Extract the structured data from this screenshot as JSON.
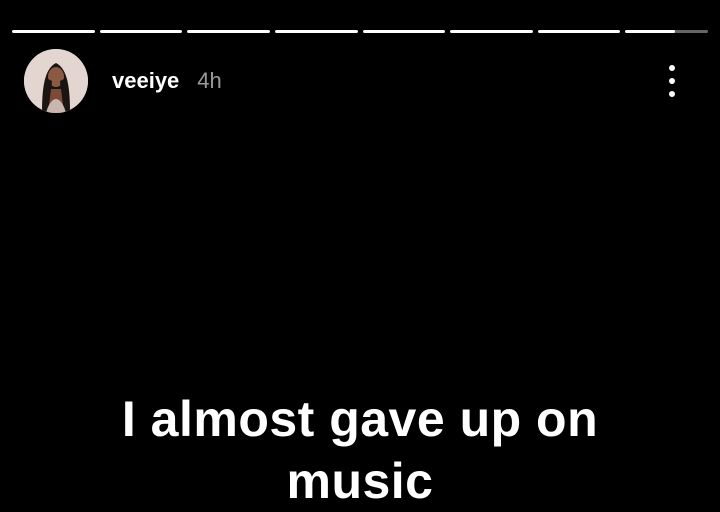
{
  "progress": {
    "segments": [
      1,
      1,
      1,
      1,
      1,
      1,
      1,
      0.6
    ]
  },
  "header": {
    "username": "veeiye",
    "time": "4h",
    "avatar_icon": "profile-photo",
    "more_icon": "more-vertical-icon"
  },
  "story": {
    "lines": [
      "I almost gave up on",
      "music"
    ]
  }
}
